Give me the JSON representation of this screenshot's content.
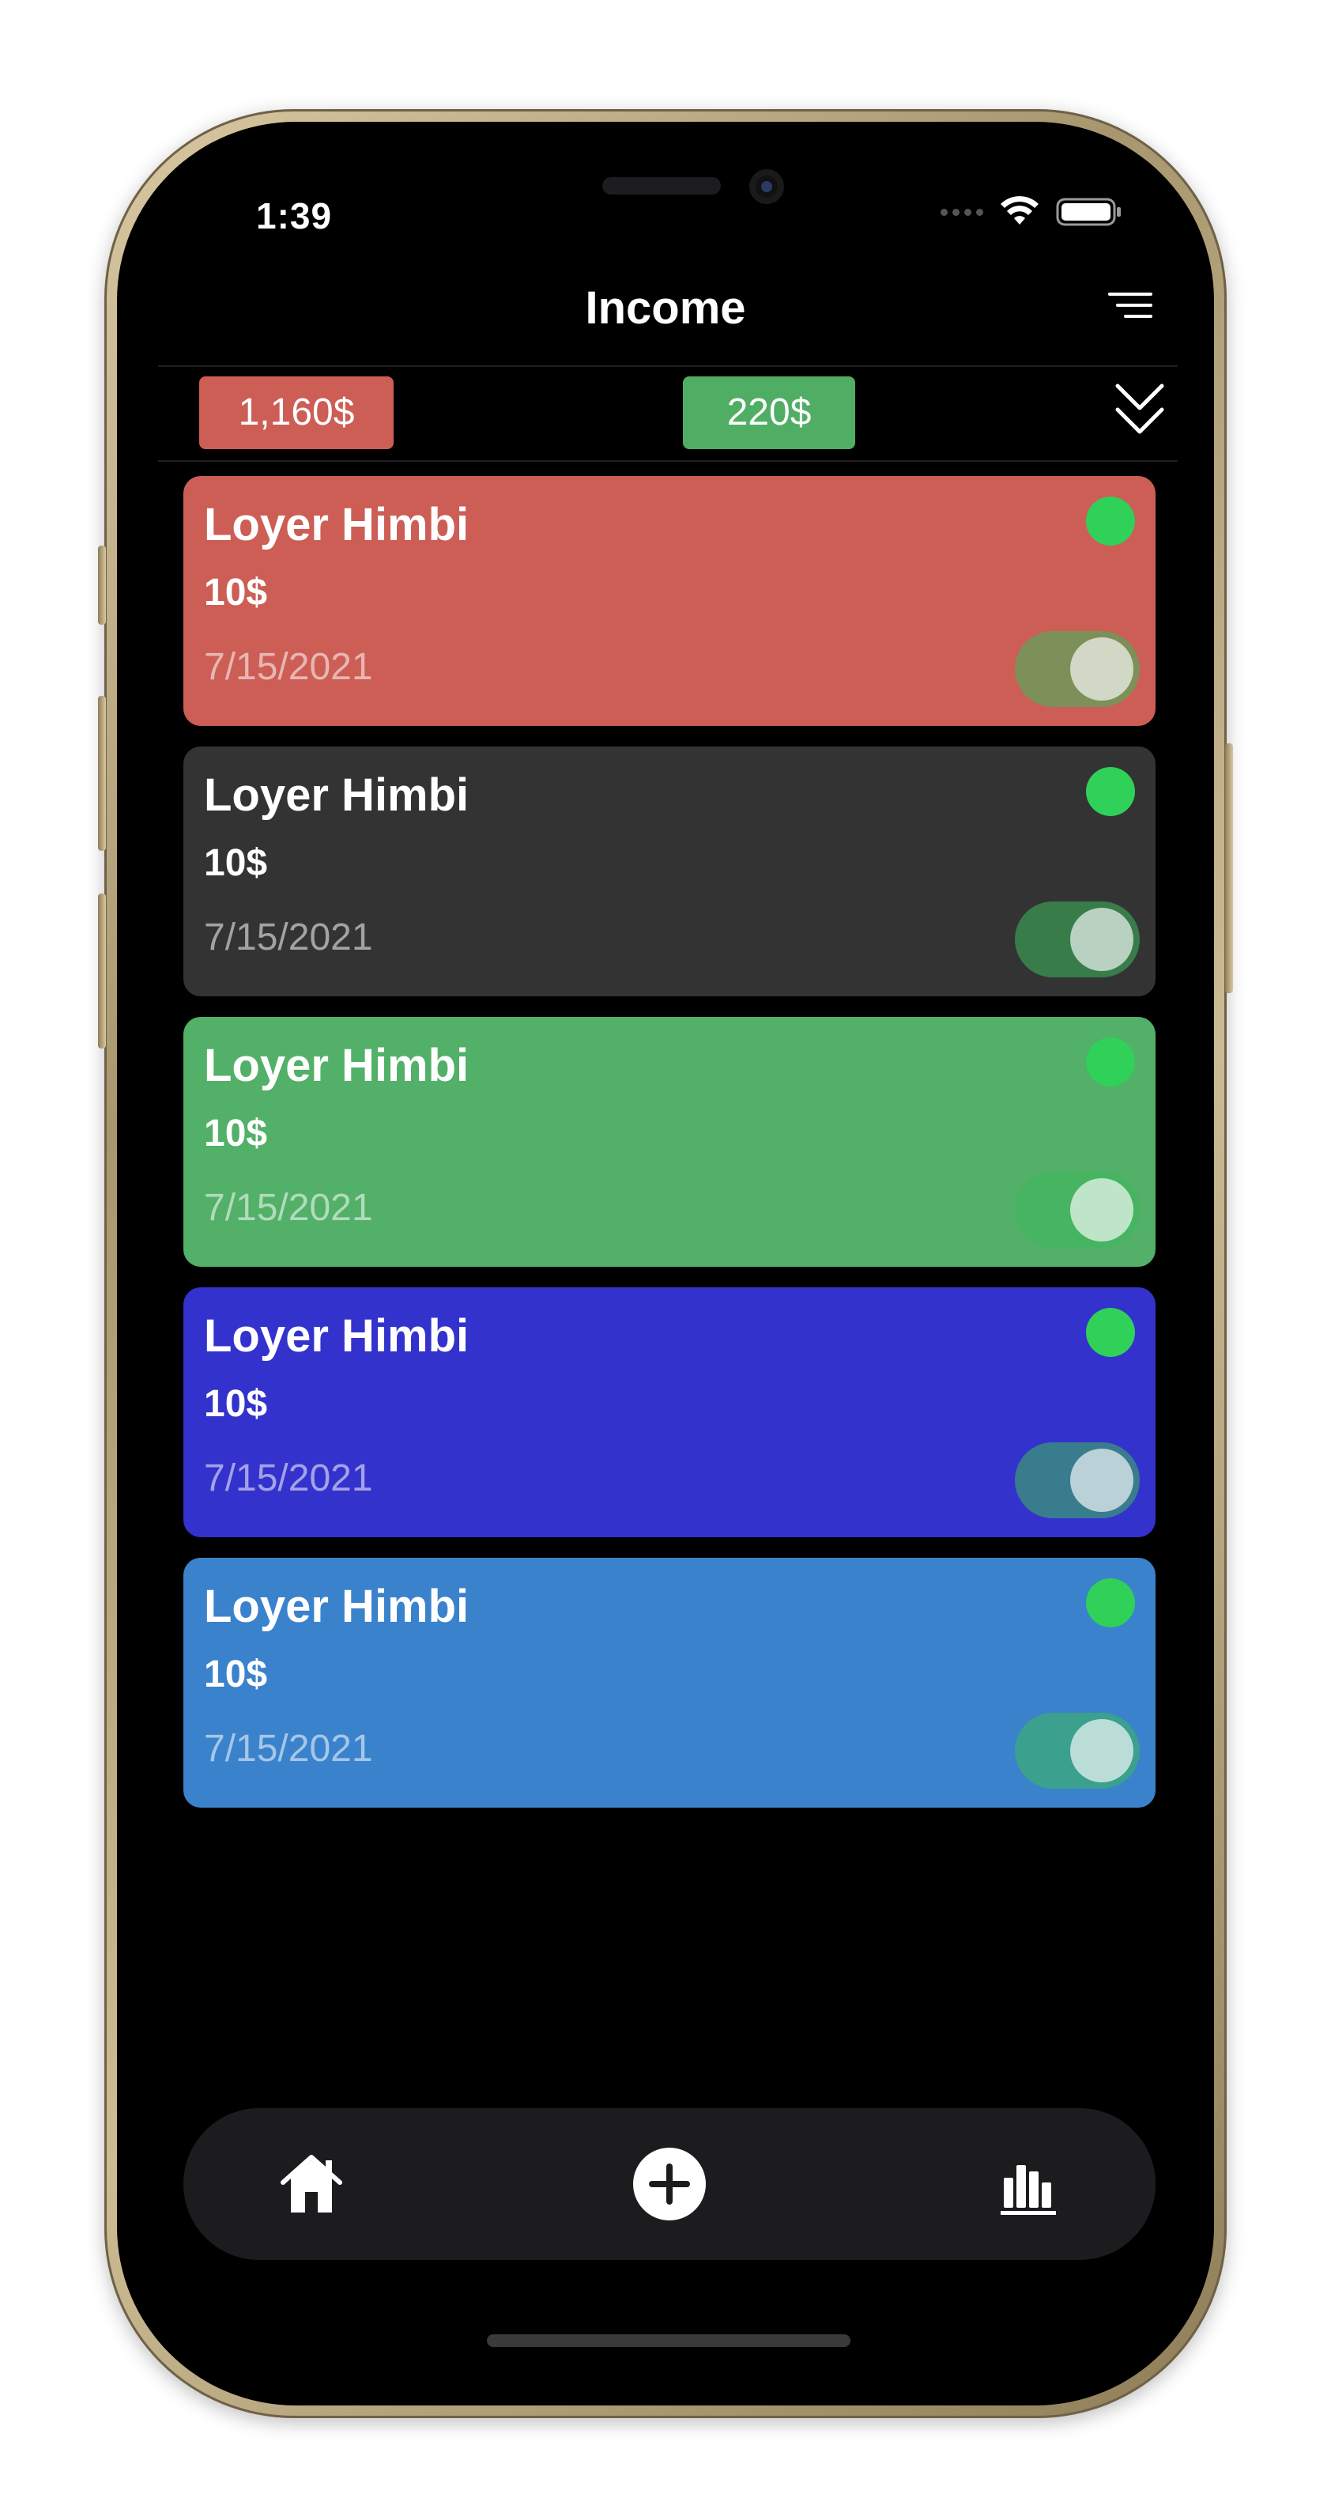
{
  "status_bar": {
    "time": "1:39"
  },
  "header": {
    "title": "Income",
    "filter_icon": "filter-lines-icon"
  },
  "summary": {
    "expense_total": "1,160$",
    "income_total": "220$",
    "collapse_icon": "double-chevron-down-icon",
    "colors": {
      "expense": "#cc5e56",
      "income": "#4fae63"
    }
  },
  "cards": [
    {
      "title": "Loyer Himbi",
      "amount": "10$",
      "date": "7/15/2021",
      "color": "#cc5e56",
      "toggle_on": true
    },
    {
      "title": "Loyer Himbi",
      "amount": "10$",
      "date": "7/15/2021",
      "color": "#333333",
      "toggle_on": true
    },
    {
      "title": "Loyer Himbi",
      "amount": "10$",
      "date": "7/15/2021",
      "color": "#52b068",
      "toggle_on": true
    },
    {
      "title": "Loyer Himbi",
      "amount": "10$",
      "date": "7/15/2021",
      "color": "#3432cc",
      "toggle_on": true
    },
    {
      "title": "Loyer Himbi",
      "amount": "10$",
      "date": "7/15/2021",
      "color": "#3a82cc",
      "toggle_on": true
    }
  ],
  "status_dot_color": "#2fd158",
  "tabbar": {
    "items": [
      {
        "icon": "home-icon"
      },
      {
        "icon": "add-circle-icon"
      },
      {
        "icon": "bar-chart-icon"
      }
    ]
  }
}
